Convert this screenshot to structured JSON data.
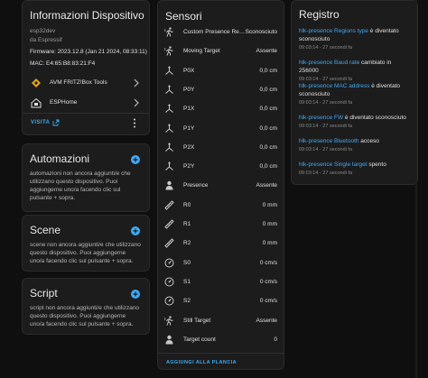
{
  "device": {
    "title": "Informazioni Dispositivo",
    "model": "esp32dev",
    "manufacturer": "da Espressif",
    "firmware": "Firmware: 2023.12.8 (Jan 21 2024, 08:33:11)",
    "mac": "MAC: E4:65:B8:83:21:F4",
    "links": [
      {
        "label": "AVM FRITZ!Box Tools",
        "icon": "fritzbox-icon"
      },
      {
        "label": "ESPHome",
        "icon": "esphome-icon"
      }
    ],
    "visit_label": "VISITA"
  },
  "automations": {
    "title": "Automazioni",
    "text": "automazioni non ancora aggiunti/e che utilizzano questo dispositivo. Puoi aggiungerne uno/a facendo clic sul pulsante + sopra."
  },
  "scenes": {
    "title": "Scene",
    "text": "scene non ancora aggiunti/e che utilizzano questo dispositivo. Puoi aggiungerne uno/a facendo clic sul pulsante + sopra."
  },
  "scripts": {
    "title": "Script",
    "text": "script non ancora aggiunti/e che utilizzano questo dispositivo. Puoi aggiungerne uno/a facendo clic sul pulsante + sopra."
  },
  "sensors": {
    "title": "Sensori",
    "rows": [
      {
        "name": "Custom Presence Regio…",
        "value": "Sconosciuto",
        "icon": "motion-icon"
      },
      {
        "name": "Moving Target",
        "value": "Assente",
        "icon": "motion-icon"
      },
      {
        "name": "P0X",
        "value": "0,0 cm",
        "icon": "axis-icon"
      },
      {
        "name": "P0Y",
        "value": "0,0 cm",
        "icon": "axis-icon"
      },
      {
        "name": "P1X",
        "value": "0,0 cm",
        "icon": "axis-icon"
      },
      {
        "name": "P1Y",
        "value": "0,0 cm",
        "icon": "axis-icon"
      },
      {
        "name": "P2X",
        "value": "0,0 cm",
        "icon": "axis-icon"
      },
      {
        "name": "P2Y",
        "value": "0,0 cm",
        "icon": "axis-icon"
      },
      {
        "name": "Presence",
        "value": "Assente",
        "icon": "person-icon"
      },
      {
        "name": "R0",
        "value": "0 mm",
        "icon": "ruler-icon"
      },
      {
        "name": "R1",
        "value": "0 mm",
        "icon": "ruler-icon"
      },
      {
        "name": "R2",
        "value": "0 mm",
        "icon": "ruler-icon"
      },
      {
        "name": "S0",
        "value": "0 cm/s",
        "icon": "speed-icon"
      },
      {
        "name": "S1",
        "value": "0 cm/s",
        "icon": "speed-icon"
      },
      {
        "name": "S2",
        "value": "0 cm/s",
        "icon": "speed-icon"
      },
      {
        "name": "Still Target",
        "value": "Assente",
        "icon": "motion-icon"
      },
      {
        "name": "Target count",
        "value": "0",
        "icon": "person-icon"
      }
    ],
    "add_label": "AGGIUNGI ALLA PLANCIA"
  },
  "log": {
    "title": "Registro",
    "entries": [
      {
        "entity": "hlk-presence Regions type",
        "text": " è diventato sconosciuto",
        "time": "09:03:14 - 27 secondi fa"
      },
      {
        "entity": "hlk-presence Baud rate",
        "text": " cambiato in 256000",
        "time": "09:03:14 - 27 secondi fa"
      },
      {
        "entity": "hlk-presence MAC address",
        "text": " è diventato sconosciuto",
        "time": "09:03:14 - 27 secondi fa"
      },
      {
        "entity": "hlk-presence FW",
        "text": " è diventato sconosciuto",
        "time": "09:03:14 - 27 secondi fa"
      },
      {
        "entity": "hlk-presence Bluetooth",
        "text": " acceso",
        "time": "09:03:14 - 27 secondi fa"
      },
      {
        "entity": "hlk-presence Single target",
        "text": " spento",
        "time": "09:03:14 - 27 secondi fa"
      }
    ]
  },
  "colors": {
    "accent": "#3fa9f5",
    "card": "#1c1c1c",
    "background": "#0f0f10",
    "fritz": "#e0a21e"
  }
}
